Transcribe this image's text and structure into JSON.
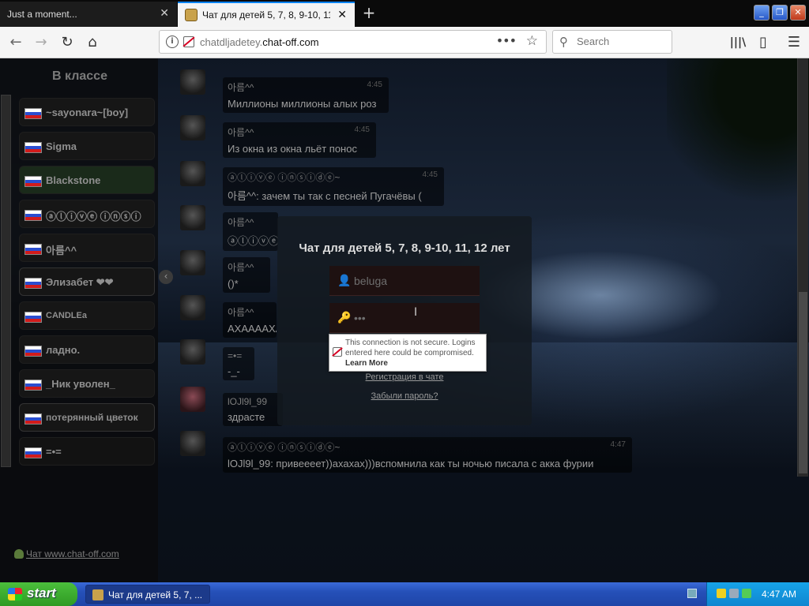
{
  "browser": {
    "tabs": [
      {
        "label": "Just a moment..."
      },
      {
        "label": "Чат для детей 5, 7, 8, 9-10, 11, 12 лет"
      }
    ],
    "url_domain_prefix": "chatdljadetey.",
    "url_domain": "chat-off.com",
    "search_placeholder": "Search",
    "icons": {
      "back": "←",
      "forward": "→",
      "reload": "↻",
      "home": "⌂",
      "page_actions": "•••",
      "bookmark": "☆",
      "library": "|||\\",
      "sidebar": "▯",
      "menu": "☰",
      "close": "✕",
      "new_tab": "+",
      "search": "⚲"
    }
  },
  "sidebar": {
    "title": "В классе",
    "users": [
      {
        "nick": "~sayonara~[boy]"
      },
      {
        "nick": "Sigma"
      },
      {
        "nick": "Blackstone"
      },
      {
        "nick": "ⓐⓛⓘⓥⓔ ⓘⓝⓢⓘ"
      },
      {
        "nick": "아름^^"
      },
      {
        "nick": "Элизабет ❤❤"
      },
      {
        "nick": "CANDLEa"
      },
      {
        "nick": "ладно."
      },
      {
        "nick": "_Ник уволен_"
      },
      {
        "nick": "потерянный цветок"
      },
      {
        "nick": "=•="
      }
    ],
    "footer": "Чат www.chat-off.com"
  },
  "chat": {
    "messages": [
      {
        "author": "아름^^",
        "text": "Миллионы миллионы алых роз",
        "time": "4:45"
      },
      {
        "author": "아름^^",
        "text": "Из окна из окна льёт понос",
        "time": "4:45"
      },
      {
        "author": "ⓐⓛⓘⓥⓔ ⓘⓝⓢⓘⓓⓔ~",
        "text": "아름^^: зачем ты так с песней Пугачёвы (",
        "time": "4:45"
      },
      {
        "author": "아름^^",
        "text": "ⓐⓛⓘⓥⓔ ⓘⓝⓢⓘⓓⓔ~ )",
        "time": ""
      },
      {
        "author": "아름^^",
        "text": "()*",
        "time": ""
      },
      {
        "author": "아름^^",
        "text": "АХААААХАХАХАХАХАХАХА",
        "time": ""
      },
      {
        "author": "=•=",
        "text": "-_-",
        "time": ""
      },
      {
        "author": "lOJl9l_99",
        "text": "здрасте",
        "time": ""
      },
      {
        "author": "ⓐⓛⓘⓥⓔ ⓘⓝⓢⓘⓓⓔ~",
        "text": "lOJl9l_99: привеееет))ахахах)))вспомнила как ты ночью писала с акка фурии",
        "time": "4:47"
      }
    ]
  },
  "login": {
    "title": "Чат для детей 5, 7, 8, 9-10, 11, 12 лет",
    "username": "beluga",
    "password_mask": "•••",
    "register_link": "Регистрация в чате",
    "forgot_link": "Забыли пароль?"
  },
  "insecure_tip": {
    "text": "This connection is not secure. Logins entered here could be compromised.",
    "learn_more": "Learn More"
  },
  "taskbar": {
    "start": "start",
    "task_label": "Чат для детей 5, 7, ...",
    "clock": "4:47 AM"
  },
  "colors": {
    "accent_tab": "#0a84ff",
    "insecure_red": "#d70022",
    "taskbar_blue": "#2550b8",
    "start_green": "#3aa82d"
  }
}
